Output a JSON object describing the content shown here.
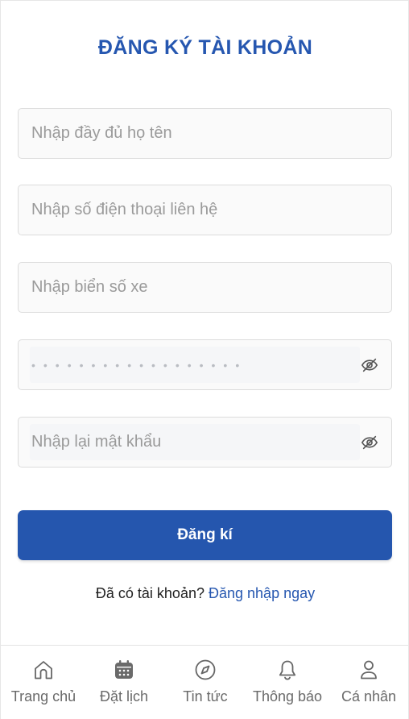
{
  "form": {
    "title": "ĐĂNG KÝ TÀI KHOẢN",
    "full_name_placeholder": "Nhập đầy đủ họ tên",
    "phone_placeholder": "Nhập số điện thoại liên hệ",
    "plate_placeholder": "Nhập biển số xe",
    "password_value": "••••••••••••••••••",
    "confirm_password_placeholder": "Nhập lại mật khẩu",
    "submit_label": "Đăng kí",
    "have_account_text": "Đã có tài khoản?",
    "login_link": "Đăng nhập ngay"
  },
  "nav": {
    "items": [
      {
        "label": "Trang chủ",
        "icon": "home-icon"
      },
      {
        "label": "Đặt lịch",
        "icon": "calendar-icon"
      },
      {
        "label": "Tin tức",
        "icon": "compass-icon"
      },
      {
        "label": "Thông báo",
        "icon": "bell-icon"
      },
      {
        "label": "Cá nhân",
        "icon": "user-icon"
      }
    ]
  },
  "colors": {
    "primary": "#2556ae",
    "title": "#2657b0",
    "nav_icon": "#6a6a6a"
  }
}
